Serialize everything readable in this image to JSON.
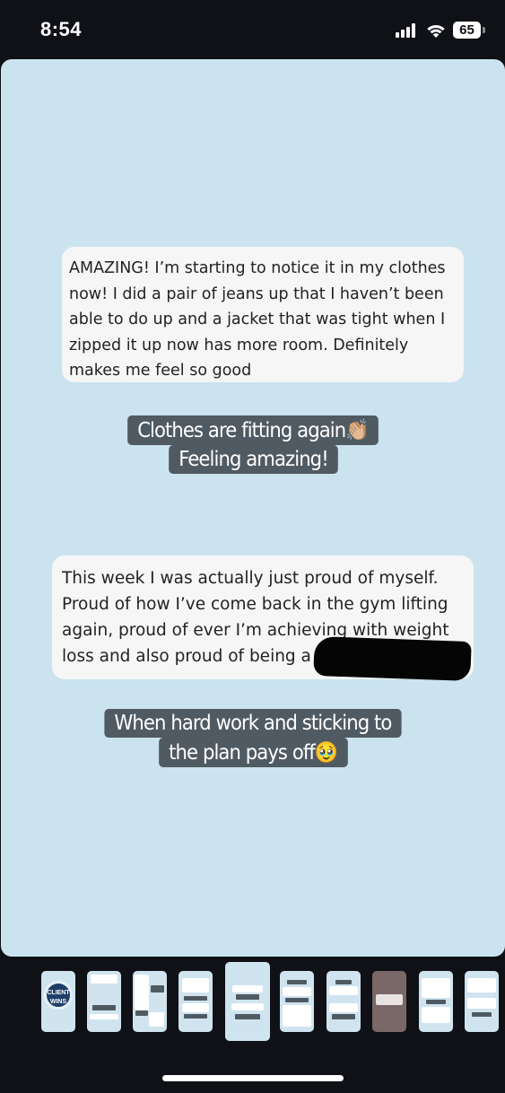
{
  "status_bar": {
    "time": "8:54",
    "battery": "65"
  },
  "story": {
    "background_color": "#cbe3ef",
    "messages": [
      {
        "text": "AMAZING! I’m starting to notice it in my clothes now! I did a pair of jeans up that I haven’t been able to do up and a jacket that was tight when I zipped it up now has more room. Definitely makes me feel so good"
      },
      {
        "text": "This week I was actually just proud of myself. Proud of how I’ve come back in the gym lifting again, proud of ever I’m achieving with weight loss and also proud of being a m"
      }
    ],
    "captions": [
      {
        "line1": "Clothes are fitting again👏🏼",
        "line2": "Feeling amazing!"
      },
      {
        "line1": "When hard work and sticking to",
        "line2": "the plan pays off🥹"
      }
    ]
  },
  "thumbnails": {
    "first_label": "CLIENT WINS",
    "count": 10,
    "active_index": 4
  }
}
